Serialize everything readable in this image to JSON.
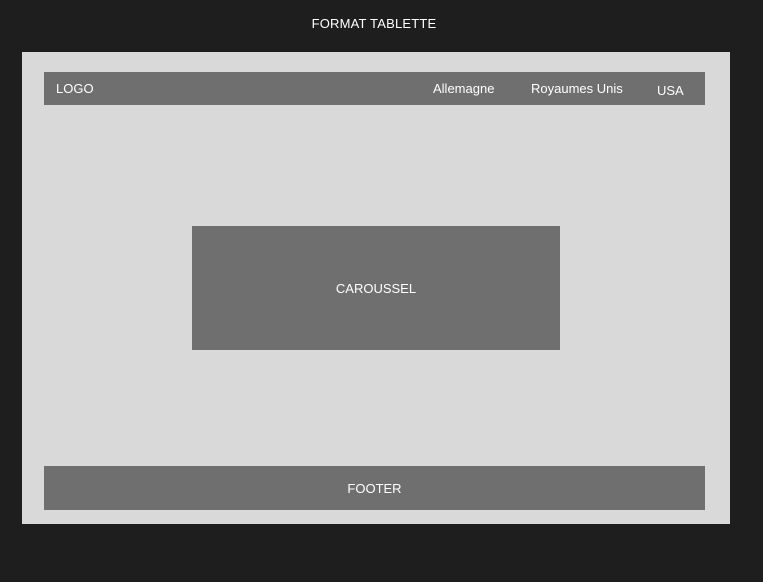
{
  "frame": {
    "title": "FORMAT TABLETTE"
  },
  "header": {
    "logo": "LOGO",
    "nav": [
      {
        "label": "Allemagne"
      },
      {
        "label": "Royaumes Unis"
      },
      {
        "label": "USA"
      }
    ]
  },
  "main": {
    "carousel_label": "CAROUSSEL"
  },
  "footer": {
    "label": "FOOTER"
  },
  "colors": {
    "canvas_background": "#1e1e1e",
    "artboard_background": "#d9d9d9",
    "block_fill": "#6f6f6f",
    "text": "#ffffff"
  }
}
